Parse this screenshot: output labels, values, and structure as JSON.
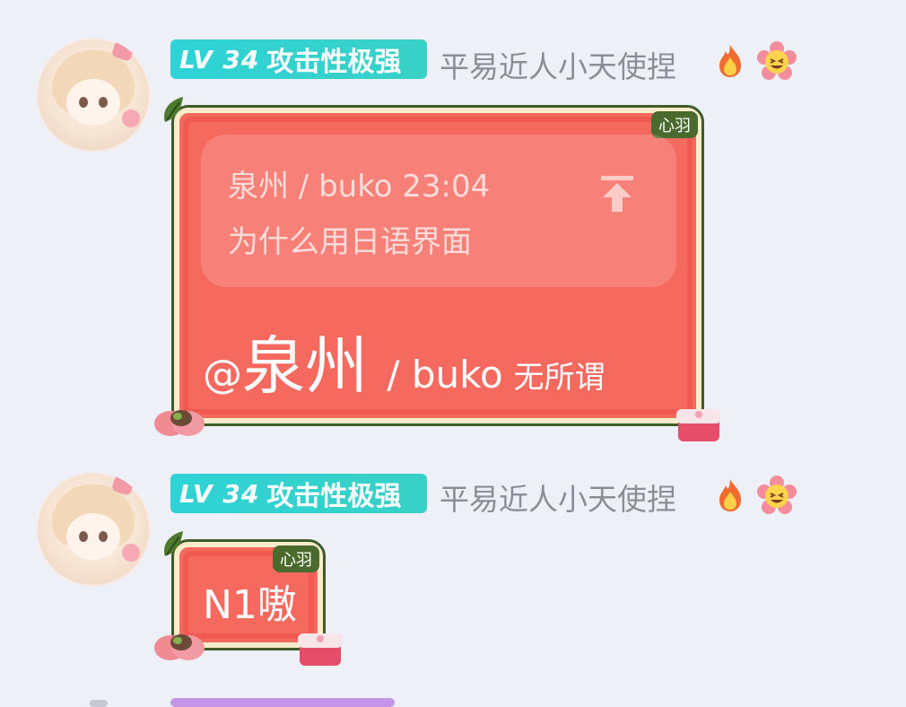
{
  "messages": [
    {
      "badge": {
        "level": "LV 34",
        "title": "攻击性极强"
      },
      "username": "平易近人小天使捏",
      "bubble_tag": "心羽",
      "reply": {
        "header": "泉州 / buko 23:04",
        "text": "为什么用日语界面"
      },
      "mention": {
        "at": "@",
        "name": "泉州",
        "handle": " / buko",
        "body": "无所谓"
      }
    },
    {
      "badge": {
        "level": "LV 34",
        "title": "攻击性极强"
      },
      "username": "平易近人小天使捏",
      "bubble_tag": "心羽",
      "text": "N1嗷"
    }
  ],
  "icons": {
    "fire": "fire-icon",
    "flower_emoji": "laughing-flower-icon",
    "jump": "jump-to-top-icon"
  },
  "colors": {
    "bubble": "#f6695f",
    "badge": "#2fd3d6",
    "page_bg": "#eef0f7"
  }
}
